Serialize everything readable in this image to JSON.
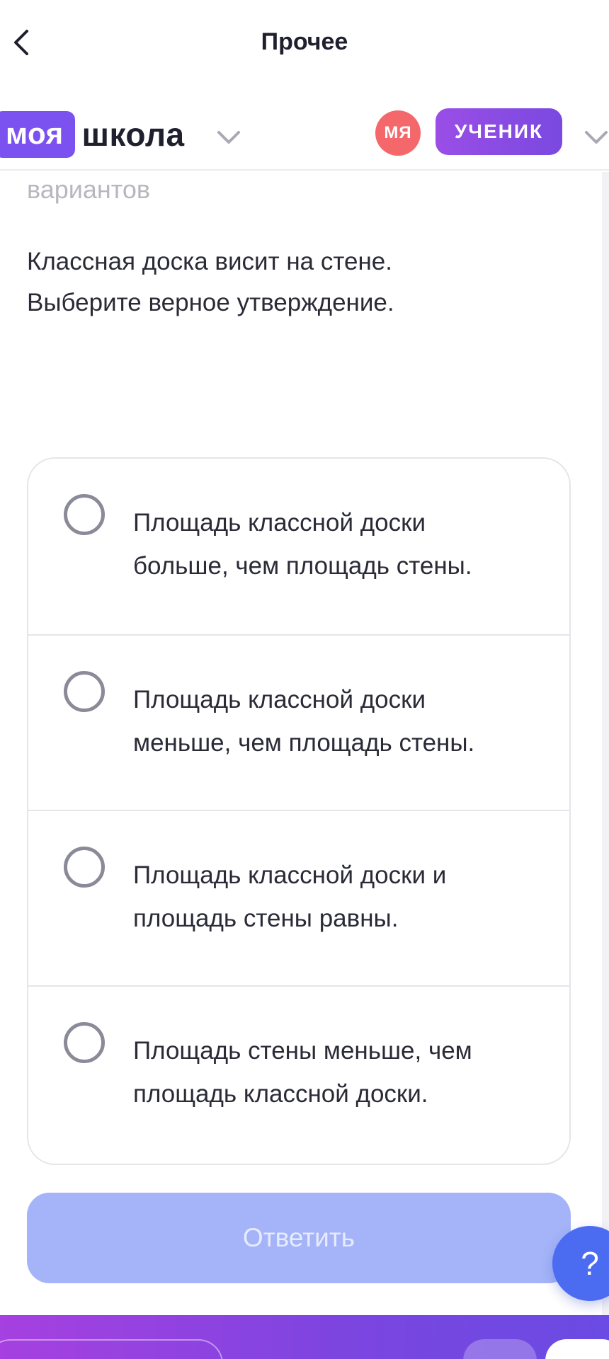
{
  "topnav": {
    "title": "Прочее",
    "back_icon": "chevron-left-icon"
  },
  "header": {
    "logo_badge": "моя",
    "logo_text": "школа",
    "avatar_initials": "МЯ",
    "role_label": "УЧЕНИК",
    "dropdown_icon": "chevron-down-icon",
    "colors": {
      "brand_purple": "#7b51f0",
      "avatar_red": "#f4676a"
    }
  },
  "task": {
    "faded_text": "вариантов",
    "question_line1": "Классная доска висит на стене.",
    "question_line2": "Выберите верное утверждение."
  },
  "options": [
    {
      "line1": "Площадь классной доски",
      "line2": "больше, чем площадь стены.",
      "selected": false
    },
    {
      "line1": "Площадь классной доски",
      "line2": "меньше, чем площадь стены.",
      "selected": false
    },
    {
      "line1": "Площадь классной доски и",
      "line2": "площадь стены равны.",
      "selected": false
    },
    {
      "line1": "Площадь стены меньше, чем",
      "line2": "площадь классной доски.",
      "selected": false
    }
  ],
  "answer_button": {
    "label": "Ответить",
    "disabled": true,
    "color": "#a5b4f8"
  },
  "help_button": {
    "label": "?",
    "color": "#4b6cf0"
  }
}
